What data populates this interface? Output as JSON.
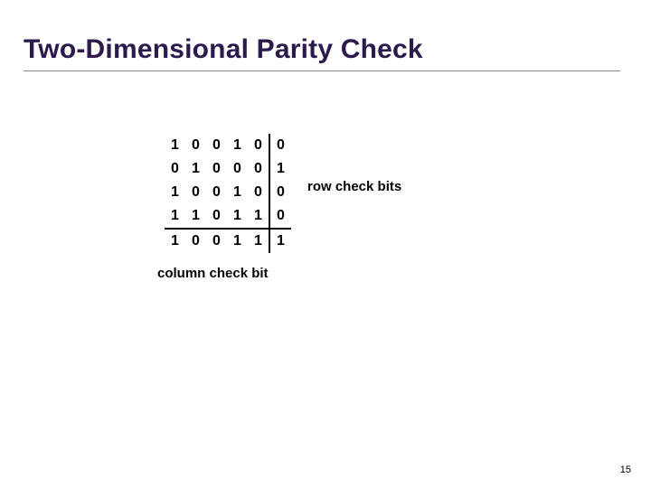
{
  "title": "Two-Dimensional Parity Check",
  "labels": {
    "row_check": "row check bits",
    "column_check": "column check bit"
  },
  "slide_number": "15",
  "parity_grid": {
    "data_rows": [
      [
        1,
        0,
        0,
        1,
        0
      ],
      [
        0,
        1,
        0,
        0,
        0
      ],
      [
        1,
        0,
        0,
        1,
        0
      ],
      [
        1,
        1,
        0,
        1,
        1
      ]
    ],
    "row_parity": [
      0,
      1,
      0,
      0
    ],
    "column_parity": [
      1,
      0,
      0,
      1,
      1
    ],
    "corner_parity": 1
  },
  "chart_data": {
    "type": "table",
    "title": "Two-Dimensional Parity Check",
    "grid": [
      [
        1,
        0,
        0,
        1,
        0,
        0
      ],
      [
        0,
        1,
        0,
        0,
        0,
        1
      ],
      [
        1,
        0,
        0,
        1,
        0,
        0
      ],
      [
        1,
        1,
        0,
        1,
        1,
        0
      ],
      [
        1,
        0,
        0,
        1,
        1,
        1
      ]
    ],
    "row_parity_column_index": 5,
    "column_parity_row_index": 4,
    "annotations": {
      "row_check_bits_label": "row check bits",
      "column_check_bit_label": "column check bit"
    }
  }
}
